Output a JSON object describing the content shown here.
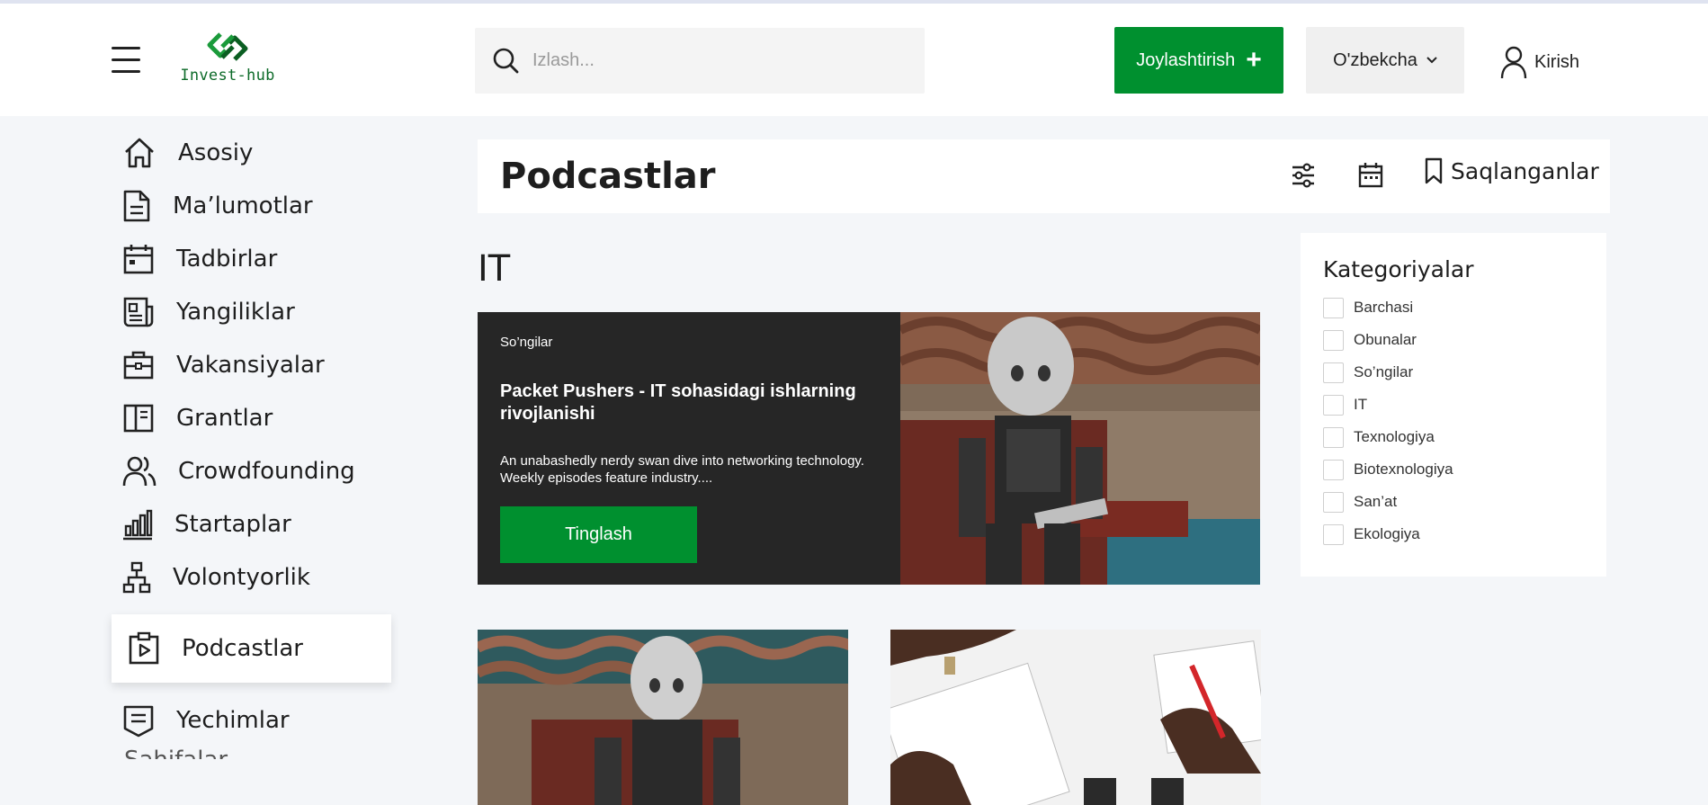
{
  "header": {
    "logo_text": "Invest-hub",
    "search_placeholder": "Izlash...",
    "post_button": "Joylashtirish",
    "language": "O'zbekcha",
    "login": "Kirish"
  },
  "sidebar": {
    "items": [
      {
        "label": "Asosiy",
        "icon": "home-icon"
      },
      {
        "label": "Ma’lumotlar",
        "icon": "document-icon"
      },
      {
        "label": "Tadbirlar",
        "icon": "calendar-icon"
      },
      {
        "label": "Yangiliklar",
        "icon": "newspaper-icon"
      },
      {
        "label": "Vakansiyalar",
        "icon": "briefcase-icon"
      },
      {
        "label": "Grantlar",
        "icon": "book-icon"
      },
      {
        "label": "Crowdfounding",
        "icon": "users-icon"
      },
      {
        "label": "Startaplar",
        "icon": "bar-chart-icon"
      },
      {
        "label": "Volontyorlik",
        "icon": "hierarchy-icon"
      },
      {
        "label": "Podcastlar",
        "icon": "podcast-icon",
        "active": true
      },
      {
        "label": "Yechimlar",
        "icon": "receipt-icon"
      }
    ],
    "cut_item": "Sahifalar"
  },
  "page": {
    "title": "Podcastlar",
    "saved_label": "Saqlanganlar",
    "section_title": "IT"
  },
  "featured": {
    "tag": "So’ngilar",
    "title": "Packet Pushers - IT sohasidagi ishlarning rivojlanishi",
    "description": "An unabashedly nerdy swan dive into networking technology. Weekly episodes feature industry....",
    "button": "Tinglash"
  },
  "categories": {
    "title": "Kategoriyalar",
    "items": [
      "Barchasi",
      "Obunalar",
      "So’ngilar",
      "IT",
      "Texnologiya",
      "Biotexnologiya",
      "San’at",
      "Ekologiya"
    ]
  },
  "colors": {
    "accent": "#00902f",
    "dark_card": "#262626",
    "background": "#f4f6f9"
  }
}
